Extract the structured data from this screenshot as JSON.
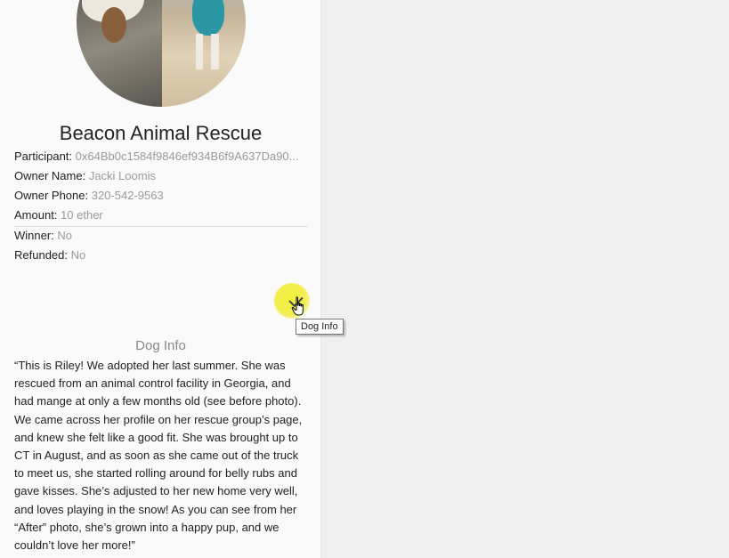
{
  "card": {
    "title": "Beacon Animal Rescue",
    "participant_label": "Participant:",
    "participant_value": "0x64Bb0c1584f9846ef934B6f9A637Da90...",
    "owner_name_label": "Owner Name:",
    "owner_name_value": "Jacki Loomis",
    "owner_phone_label": "Owner Phone:",
    "owner_phone_value": "320-542-9563",
    "amount_label": "Amount:",
    "amount_value": "10 ether",
    "winner_label": "Winner:",
    "winner_value": "No",
    "refunded_label": "Refunded:",
    "refunded_value": "No"
  },
  "tooltip": {
    "text": "Dog Info"
  },
  "dog_info": {
    "heading": "Dog Info",
    "story": "“This is Riley! We adopted her last summer. She was rescued from an animal control facility in Georgia, and had mange at only a few months old (see before photo). We came across her profile on her rescue group’s page, and knew she felt like a good fit. She was brought up to CT in August, and as soon as she came out of the truck to meet us, she started rolling around for belly rubs and gave kisses. She’s adjusted to her new home very well, and loves playing in the snow! As you can see from her “After” photo, she’s grown into a happy pup, and we couldn’t love her more!”"
  },
  "icons": {
    "check": "check-icon",
    "cursor": "hand-pointer-cursor"
  },
  "colors": {
    "highlight": "#f2ee50",
    "muted_text": "#999999"
  }
}
